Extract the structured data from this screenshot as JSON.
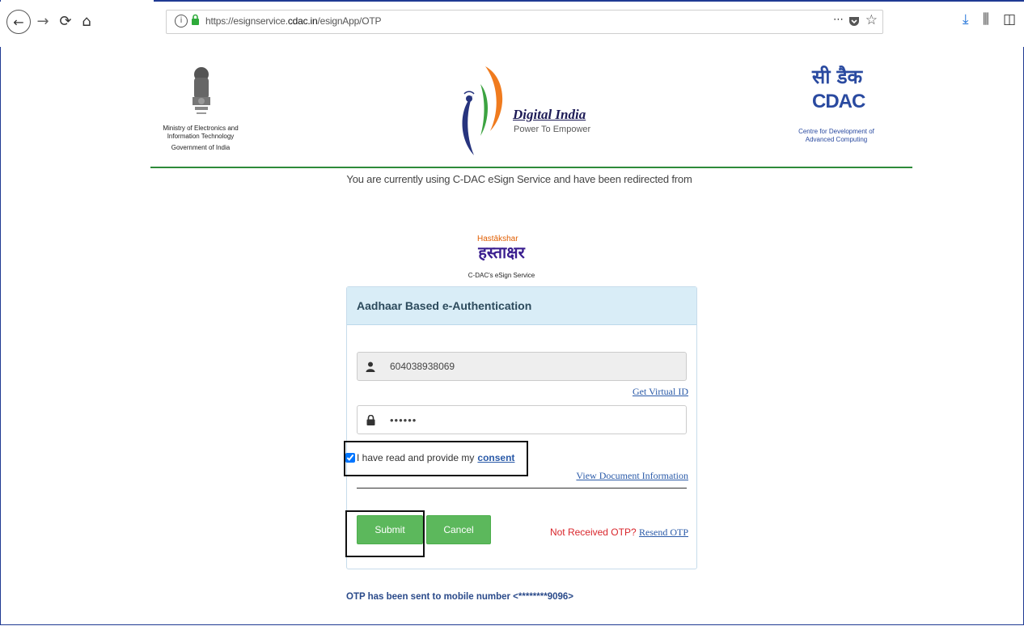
{
  "browser": {
    "url_prefix": "https://esignservice.",
    "url_domain": "cdac.in",
    "url_path": "/esignApp/OTP",
    "more_icon": "⋯",
    "star_icon": "☆"
  },
  "header": {
    "ministry_line1": "Ministry of Electronics and",
    "ministry_line2": "Information Technology",
    "ministry_gov": "Government of India",
    "digital_india_title": "Digital India",
    "digital_india_tagline": "Power To Empower",
    "cdac_hindi": "सी डैक",
    "cdac_english": "CDAC",
    "cdac_full_line1": "Centre for Development of",
    "cdac_full_line2": "Advanced Computing"
  },
  "redirect_text": "You are currently using C-DAC eSign Service and have been redirected from",
  "hastakshar": {
    "small": "Hastākshar",
    "main": "हस्ताक्षर",
    "caption": "C-DAC's eSign Service"
  },
  "auth": {
    "title": "Aadhaar Based e-Authentication",
    "aadhaar_value": "604038938069",
    "get_virtual_id": "Get Virtual ID",
    "otp_value": "••••••",
    "consent_text": "I have read and provide my",
    "consent_link": "consent",
    "view_document": "View Document Information",
    "submit_label": "Submit",
    "cancel_label": "Cancel",
    "not_received": "Not Received OTP?",
    "resend": "Resend OTP",
    "otp_sent_message": "OTP has been sent to mobile number <********9096>"
  },
  "colors": {
    "accent_green": "#5cb85c",
    "panel_head": "#d9edf7",
    "link_blue": "#2a5aa8",
    "header_rule": "#2e8b3a",
    "warn_red": "#d9262c"
  }
}
